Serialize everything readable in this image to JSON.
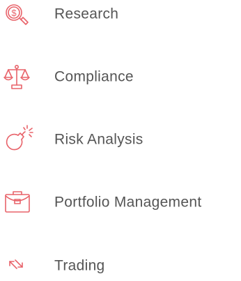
{
  "colors": {
    "accent": "#e8636a",
    "text": "#555555"
  },
  "menu": {
    "items": [
      {
        "label": "Research",
        "icon": "magnifier-dollar-icon"
      },
      {
        "label": "Compliance",
        "icon": "balance-scale-icon"
      },
      {
        "label": "Risk Analysis",
        "icon": "bomb-icon"
      },
      {
        "label": "Portfolio Management",
        "icon": "briefcase-icon"
      },
      {
        "label": "Trading",
        "icon": "exchange-arrows-icon"
      }
    ]
  }
}
